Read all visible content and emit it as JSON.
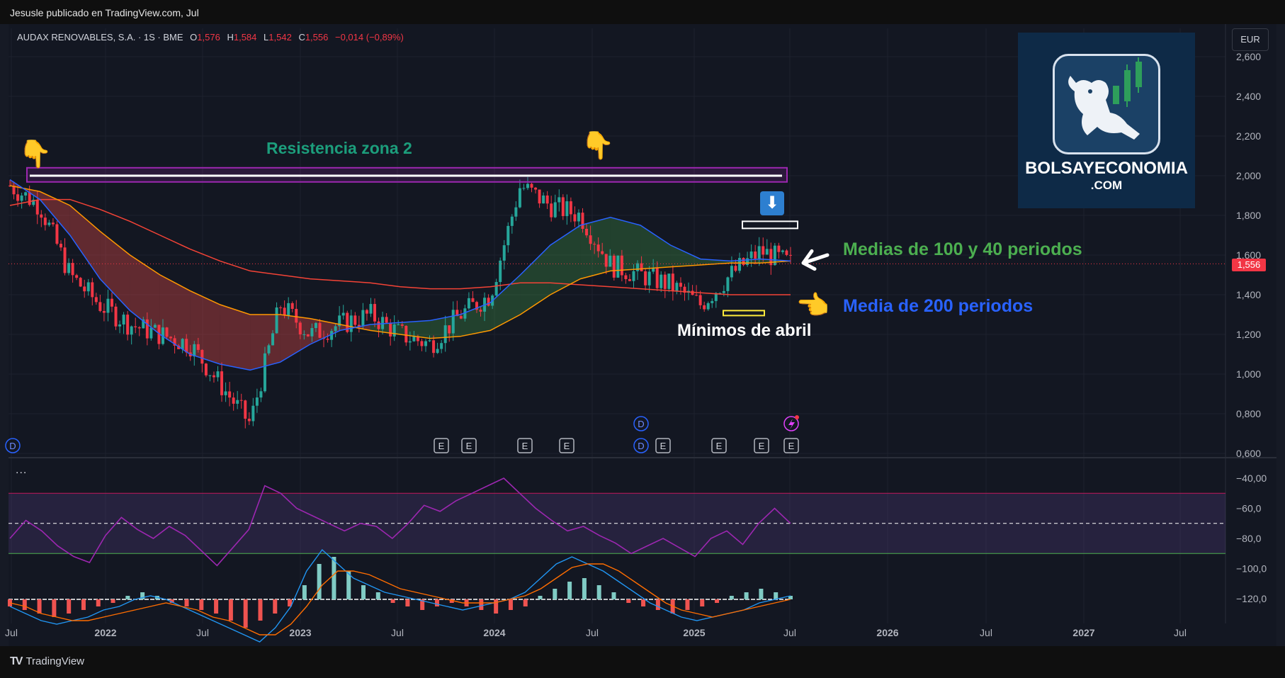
{
  "header": {
    "published_by": "Jesusle publicado en TradingView.com, Jul"
  },
  "legend": {
    "symbol": "AUDAX RENOVABLES, S.A. · 1S · BME",
    "o_label": "O",
    "o_value": "1,576",
    "h_label": "H",
    "h_value": "1,584",
    "l_label": "L",
    "l_value": "1,542",
    "c_label": "C",
    "c_value": "1,556",
    "change": "−0,014 (−0,89%)"
  },
  "currency": "EUR",
  "last_price": "1,556",
  "brand": {
    "name": "BOLSAYECONOMIA",
    "domain": ".COM"
  },
  "annotations": {
    "resistance": "Resistencia zona 2",
    "averages": "Medias de 100 y 40 periodos",
    "avg200": "Media de 200 periodos",
    "april_lows": "Mínimos de abril"
  },
  "icons": {
    "hand_left": "pointing-down-hand-icon",
    "hand_mid": "pointing-down-hand-icon",
    "hand_right": "pointing-left-hand-icon",
    "arrow": "down-arrow-icon",
    "white_arrow": "white-arrow-icon"
  },
  "footer": {
    "brand": "TradingView",
    "logo": "TV"
  },
  "more_dots": "...",
  "colors": {
    "up": "#26a69a",
    "down": "#f23645",
    "ma40": "#2962ff",
    "ma100": "#ff9800",
    "ma200": "#f44336",
    "rsi": "#9c27b0",
    "resistance": "#9c27b0",
    "macd": "#2196f3",
    "signal": "#ff6d00"
  },
  "chart_data": [
    {
      "type": "candlestick",
      "title": "AUDAX RENOVABLES, S.A. · 1S · BME",
      "x_ticks": [
        "Jul",
        "2022",
        "Jul",
        "2023",
        "Jul",
        "2024",
        "Jul",
        "2025",
        "Jul",
        "2026",
        "Jul",
        "2027",
        "Jul"
      ],
      "y_ticks": [
        "2,600",
        "2,400",
        "2,200",
        "2,000",
        "1,800",
        "1,600",
        "1,400",
        "1,200",
        "1,000",
        "0,800",
        "0,600"
      ],
      "ylim": [
        0.6,
        2.6
      ],
      "events": [
        "D",
        "E",
        "E",
        "E",
        "E",
        "D",
        "E",
        "E",
        "E",
        "E",
        "D"
      ],
      "series": [
        {
          "name": "close",
          "x": [
            "2021-07",
            "2021-09",
            "2021-11",
            "2022-01",
            "2022-03",
            "2022-05",
            "2022-07",
            "2022-09",
            "2022-11",
            "2023-01",
            "2023-03",
            "2023-05",
            "2023-07",
            "2023-09",
            "2023-11",
            "2024-01",
            "2024-03",
            "2024-05",
            "2024-07",
            "2024-09",
            "2024-11",
            "2025-01",
            "2025-03",
            "2025-04",
            "2025-05",
            "2025-06",
            "2025-07"
          ],
          "values": [
            1.95,
            1.85,
            1.5,
            1.35,
            1.25,
            1.2,
            1.15,
            0.95,
            0.75,
            1.35,
            1.2,
            1.25,
            1.3,
            1.2,
            1.15,
            1.3,
            1.4,
            1.95,
            1.85,
            1.8,
            1.55,
            1.5,
            1.45,
            1.35,
            1.5,
            1.62,
            1.556
          ]
        },
        {
          "name": "",
          "color": "#2962ff",
          "values": [
            1.98,
            1.88,
            1.7,
            1.48,
            1.32,
            1.2,
            1.1,
            1.05,
            1.02,
            1.06,
            1.15,
            1.22,
            1.25,
            1.26,
            1.27,
            1.3,
            1.36,
            1.5,
            1.65,
            1.75,
            1.79,
            1.75,
            1.65,
            1.58,
            1.57,
            1.58,
            1.57
          ]
        },
        {
          "name": "",
          "color": "#ff9800",
          "values": [
            1.95,
            1.92,
            1.85,
            1.72,
            1.6,
            1.5,
            1.42,
            1.35,
            1.3,
            1.3,
            1.28,
            1.25,
            1.22,
            1.2,
            1.18,
            1.19,
            1.22,
            1.3,
            1.4,
            1.48,
            1.52,
            1.53,
            1.54,
            1.55,
            1.56,
            1.56,
            1.57
          ]
        },
        {
          "name": "",
          "color": "#f44336",
          "values": [
            1.85,
            1.88,
            1.88,
            1.83,
            1.77,
            1.7,
            1.63,
            1.57,
            1.52,
            1.5,
            1.48,
            1.47,
            1.46,
            1.44,
            1.43,
            1.43,
            1.44,
            1.46,
            1.46,
            1.45,
            1.44,
            1.43,
            1.42,
            1.41,
            1.4,
            1.4,
            1.4
          ]
        }
      ],
      "resistance_level": 2.0,
      "april_low": 1.3
    },
    {
      "type": "line",
      "y_ticks": [
        "−40,00",
        "−60,0",
        "−80,0",
        "−100,0",
        "−120,0"
      ],
      "ylim": [
        -120,
        -40
      ],
      "bands": {
        "upper": -50,
        "middle": -70,
        "lower": -90
      },
      "series": [
        {
          "name": "",
          "color": "#9c27b0",
          "values": [
            -80,
            -68,
            -75,
            -85,
            -92,
            -96,
            -78,
            -66,
            -74,
            -80,
            -72,
            -78,
            -88,
            -98,
            -86,
            -74,
            -45,
            -50,
            -60,
            -65,
            -70,
            -75,
            -70,
            -72,
            -80,
            -70,
            -58,
            -62,
            -55,
            -50,
            -45,
            -40,
            -50,
            -60,
            -68,
            -75,
            -72,
            -78,
            -83,
            -90,
            -85,
            -80,
            -86,
            -92,
            -80,
            -75,
            -84,
            -70,
            -60,
            -70
          ]
        }
      ]
    },
    {
      "type": "bar",
      "series": [
        {
          "name": "histogram",
          "values": [
            -2,
            -3,
            -4,
            -5,
            -4,
            -3,
            -2,
            -1,
            1,
            2,
            1,
            -1,
            -2,
            -3,
            -4,
            -6,
            -8,
            -6,
            -4,
            -2,
            4,
            10,
            12,
            8,
            4,
            2,
            -1,
            -2,
            -3,
            -2,
            -1,
            -2,
            -3,
            -4,
            -3,
            -2,
            1,
            3,
            5,
            6,
            4,
            2,
            -1,
            -2,
            -3,
            -4,
            -3,
            -2,
            -1,
            1,
            2,
            3,
            2,
            1
          ]
        },
        {
          "name": "macd",
          "values": [
            -2,
            -4,
            -6,
            -7,
            -6,
            -5,
            -3,
            -2,
            0,
            1,
            0,
            -2,
            -4,
            -6,
            -8,
            -10,
            -12,
            -8,
            -2,
            8,
            14,
            10,
            6,
            4,
            2,
            1,
            0,
            -1,
            -2,
            -3,
            -2,
            -1,
            0,
            2,
            6,
            10,
            12,
            10,
            8,
            5,
            2,
            -1,
            -3,
            -5,
            -6,
            -5,
            -4,
            -3,
            -1,
            0,
            1
          ]
        },
        {
          "name": "signal",
          "values": [
            -1,
            -2,
            -4,
            -5,
            -6,
            -6,
            -5,
            -4,
            -3,
            -2,
            -1,
            -2,
            -3,
            -5,
            -6,
            -8,
            -10,
            -10,
            -7,
            -2,
            4,
            8,
            8,
            7,
            5,
            3,
            2,
            1,
            0,
            -1,
            -1,
            -1,
            0,
            1,
            3,
            6,
            9,
            10,
            10,
            8,
            5,
            2,
            -1,
            -3,
            -4,
            -5,
            -4,
            -3,
            -2,
            -1,
            0
          ]
        }
      ]
    }
  ]
}
